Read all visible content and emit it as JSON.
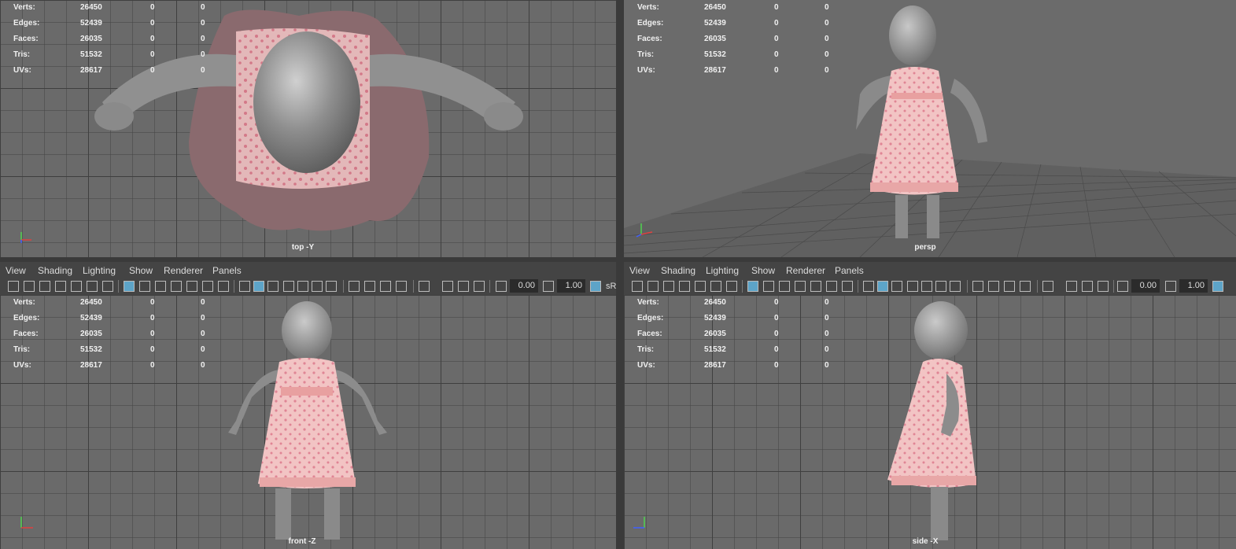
{
  "stats": {
    "labels": [
      "Verts:",
      "Edges:",
      "Faces:",
      "Tris:",
      "UVs:"
    ],
    "values": [
      "26450",
      "52439",
      "26035",
      "51532",
      "28617"
    ],
    "zero": "0"
  },
  "viewports": {
    "top": {
      "label": "top -Y"
    },
    "persp": {
      "label": "persp"
    },
    "front": {
      "label": "front -Z"
    },
    "side": {
      "label": "side -X"
    }
  },
  "menu": [
    "View",
    "Shading",
    "Lighting",
    "Show",
    "Renderer",
    "Panels"
  ],
  "toolbar": {
    "field1": "0.00",
    "field2": "1.00",
    "right_label": "sR"
  },
  "colors": {
    "viewport_bg": "#6a6a6a",
    "dress": "#f1b8b8",
    "skin": "#9a9a9a",
    "active_icon": "#5da4c8"
  }
}
